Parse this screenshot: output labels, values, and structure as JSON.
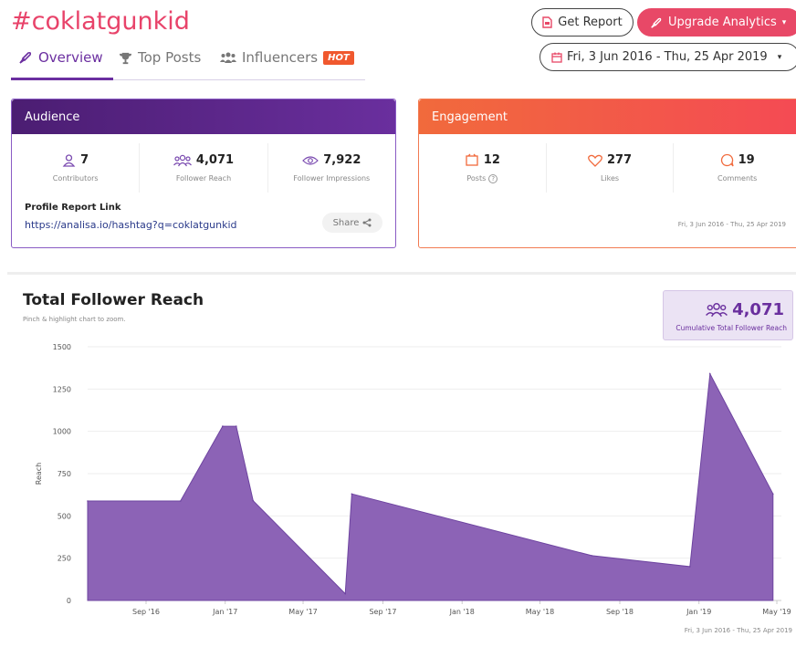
{
  "header": {
    "hashtag": "#coklatgunkid",
    "get_report": "Get Report",
    "upgrade": "Upgrade Analytics",
    "date_range": "Fri, 3 Jun 2016 - Thu, 25 Apr 2019"
  },
  "tabs": [
    {
      "label": "Overview",
      "icon": "rocket-icon"
    },
    {
      "label": "Top Posts",
      "icon": "trophy-icon"
    },
    {
      "label": "Influencers",
      "icon": "group-icon",
      "badge": "HOT"
    }
  ],
  "audience": {
    "title": "Audience",
    "stats": [
      {
        "value": "7",
        "label": "Contributors",
        "icon": "person-icon"
      },
      {
        "value": "4,071",
        "label": "Follower Reach",
        "icon": "people-icon"
      },
      {
        "value": "7,922",
        "label": "Follower Impressions",
        "icon": "eye-icon"
      }
    ],
    "profile_label": "Profile Report Link",
    "profile_link": "https://analisa.io/hashtag?q=coklatgunkid",
    "share": "Share"
  },
  "engagement": {
    "title": "Engagement",
    "stats": [
      {
        "value": "12",
        "label": "Posts",
        "icon": "posts-icon"
      },
      {
        "value": "277",
        "label": "Likes",
        "icon": "heart-icon"
      },
      {
        "value": "19",
        "label": "Comments",
        "icon": "comment-icon"
      }
    ],
    "date": "Fri, 3 Jun 2016 - Thu, 25 Apr 2019"
  },
  "reach": {
    "title": "Total Follower Reach",
    "subtitle": "Pinch & highlight chart to zoom.",
    "cumulative_value": "4,071",
    "cumulative_label": "Cumulative Total Follower Reach",
    "date": "Fri, 3 Jun 2016 - Thu, 25 Apr 2019"
  },
  "colors": {
    "accent": "#6a2f9e",
    "brand_pink": "#e84867",
    "engagement": "#f16a3c",
    "area_fill": "#8c63b6"
  },
  "chart_data": {
    "type": "area",
    "title": "Total Follower Reach",
    "ylabel": "Reach",
    "xlabel": "",
    "ylim": [
      0,
      1500
    ],
    "yticks": [
      0,
      250,
      500,
      750,
      1000,
      1250,
      1500
    ],
    "xticks": [
      {
        "label": "Sep '16",
        "date": "2016-09-01"
      },
      {
        "label": "Jan '17",
        "date": "2017-01-01"
      },
      {
        "label": "May '17",
        "date": "2017-05-01"
      },
      {
        "label": "Sep '17",
        "date": "2017-09-01"
      },
      {
        "label": "Jan '18",
        "date": "2018-01-01"
      },
      {
        "label": "May '18",
        "date": "2018-05-01"
      },
      {
        "label": "Sep '18",
        "date": "2018-09-01"
      },
      {
        "label": "Jan '19",
        "date": "2019-01-01"
      },
      {
        "label": "May '19",
        "date": "2019-05-01"
      }
    ],
    "xrange": [
      "2016-06-03",
      "2019-05-08"
    ],
    "grid": true,
    "series": [
      {
        "name": "",
        "points": [
          {
            "x": "2016-06-03",
            "y": 588
          },
          {
            "x": "2016-10-24",
            "y": 588
          },
          {
            "x": "2016-12-28",
            "y": 1030
          },
          {
            "x": "2017-01-18",
            "y": 1030
          },
          {
            "x": "2017-02-13",
            "y": 590
          },
          {
            "x": "2017-07-05",
            "y": 40
          },
          {
            "x": "2017-07-15",
            "y": 630
          },
          {
            "x": "2018-07-20",
            "y": 265
          },
          {
            "x": "2018-12-18",
            "y": 200
          },
          {
            "x": "2019-01-18",
            "y": 1340
          },
          {
            "x": "2019-04-25",
            "y": 630
          }
        ]
      }
    ]
  }
}
